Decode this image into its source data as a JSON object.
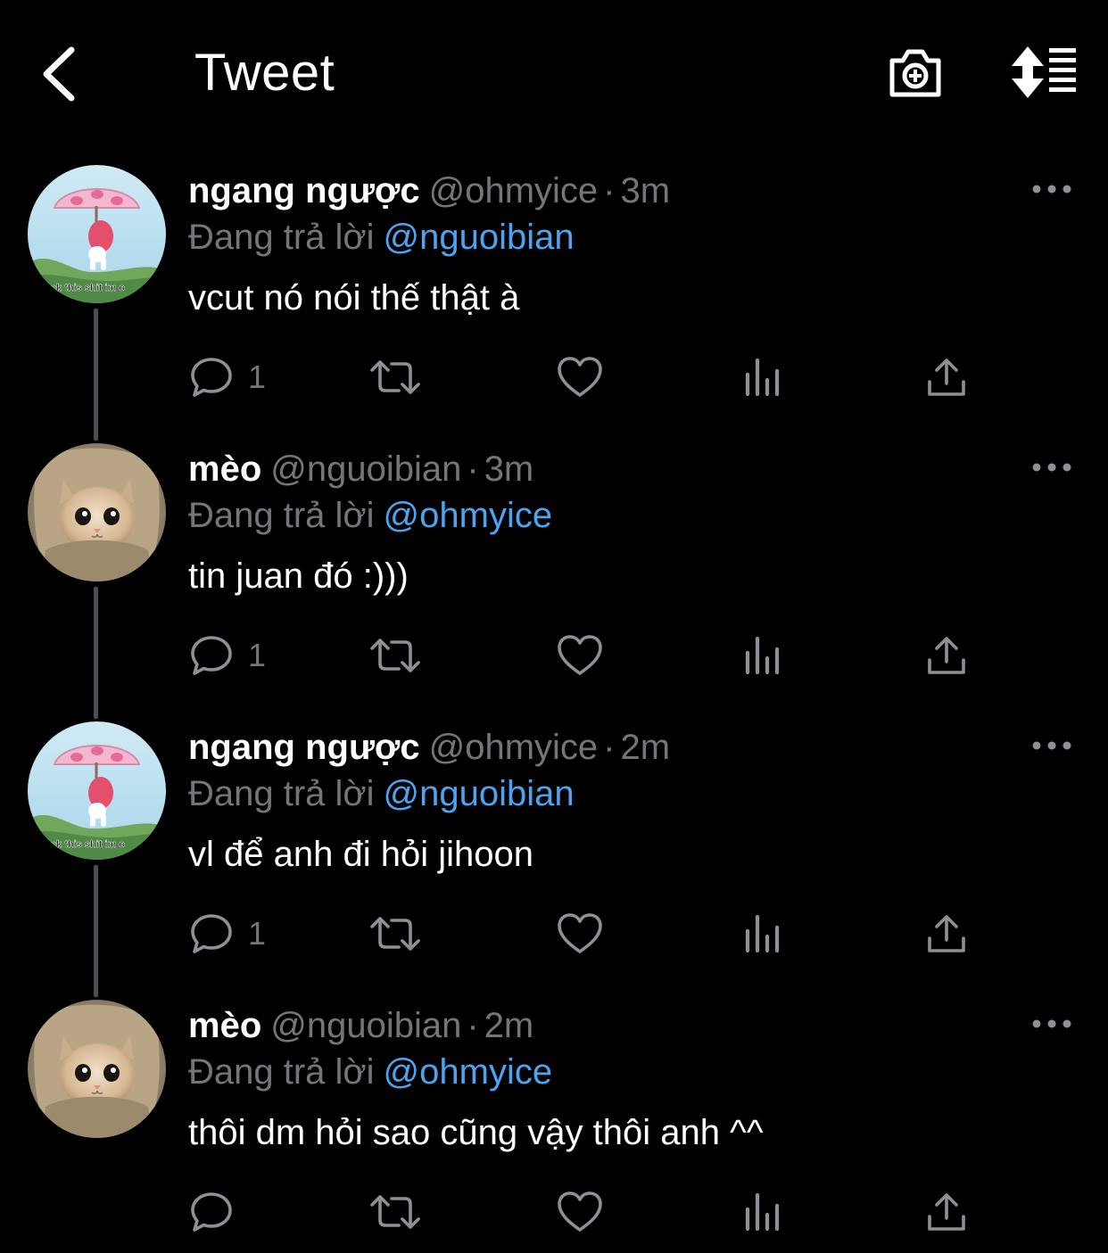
{
  "header": {
    "title": "Tweet",
    "back_icon": "chevron-left-icon",
    "camera_icon": "camera-plus-icon",
    "sort_icon": "sort-lines-icon"
  },
  "colors": {
    "background": "#000000",
    "text": "#ffffff",
    "muted": "#71767b",
    "mention": "#4da3ee",
    "thread_line": "#4a4f54"
  },
  "tweets": [
    {
      "name": "ngang ngược",
      "handle": "@ohmyice",
      "separator": "·",
      "time": "3m",
      "replying_label": "Đang trả lời",
      "replying_to": "@nguoibian",
      "text": "vcut nó nói thế thật à",
      "avatar": "umbrella-avatar",
      "avatar_caption": "fuck this shit im out",
      "reply_count": "1",
      "has_thread_line": true
    },
    {
      "name": "mèo",
      "handle": "@nguoibian",
      "separator": "·",
      "time": "3m",
      "replying_label": "Đang trả lời",
      "replying_to": "@ohmyice",
      "text": "tin juan đó :)))",
      "avatar": "cat-avatar",
      "avatar_caption": "",
      "reply_count": "1",
      "has_thread_line": true
    },
    {
      "name": "ngang ngược",
      "handle": "@ohmyice",
      "separator": "·",
      "time": "2m",
      "replying_label": "Đang trả lời",
      "replying_to": "@nguoibian",
      "text": "vl để anh đi hỏi jihoon",
      "avatar": "umbrella-avatar",
      "avatar_caption": "fuck this shit im out",
      "reply_count": "1",
      "has_thread_line": true
    },
    {
      "name": "mèo",
      "handle": "@nguoibian",
      "separator": "·",
      "time": "2m",
      "replying_label": "Đang trả lời",
      "replying_to": "@ohmyice",
      "text": "thôi dm hỏi sao cũng vậy thôi anh ^^",
      "avatar": "cat-avatar",
      "avatar_caption": "",
      "reply_count": "",
      "has_thread_line": false
    }
  ]
}
